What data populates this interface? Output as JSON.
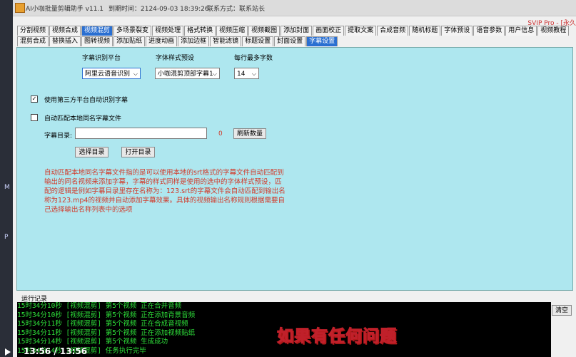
{
  "desktop": {
    "edge_letters": [
      "M",
      "P"
    ]
  },
  "title": {
    "app_name": "AI小咖批量剪辑助手 v11.1",
    "expire": "到期时间：2124-09-03 18:39:26",
    "contact": "联系方式：联系站长"
  },
  "svip_text": "SVIP Pro - [永久",
  "tabs_row1": [
    "分割视频",
    "视频合成",
    "视频混剪",
    "多场景裂变",
    "视频处理",
    "格式转换",
    "视频压缩",
    "视频截图",
    "添加封面",
    "画面校正",
    "提取文案",
    "合成音频",
    "随机标题",
    "字体预设",
    "语音参数",
    "用户信息",
    "视频教程"
  ],
  "tabs_row1_selected": "视频混剪",
  "tabs_row2": [
    "混剪合成",
    "替换插入",
    "图转视频",
    "添加贴纸",
    "进度动画",
    "添加边框",
    "智能滤镜",
    "标题设置",
    "封面设置",
    "字幕设置"
  ],
  "tabs_row2_selected": "字幕设置",
  "subtitle": {
    "platform_label": "字幕识别平台",
    "platform_value": "阿里云语音识别",
    "style_label": "字体样式预设",
    "style_value": "小咖混剪顶部字幕1",
    "maxchars_label": "每行最多字数",
    "maxchars_value": "14",
    "third_party_label": "使用第三方平台自动识别字幕",
    "third_party_checked": true,
    "auto_match_label": "自动匹配本地同名字幕文件",
    "auto_match_checked": false,
    "dir_label": "字幕目录:",
    "dir_value": "",
    "count": "0",
    "refresh_label": "刷新数量",
    "select_dir_label": "选择目录",
    "open_dir_label": "打开目录",
    "description": "自动匹配本地同名字幕文件指的是可以使用本地的srt格式的字幕文件自动匹配到输出的同名视频来添加字幕，字幕的样式同样是使用的选中的字体样式预设，匹配的逻辑是例如字幕目录里存在名称为：123.srt的字幕文件会自动匹配到输出名称为123.mp4的视频并自动添加字幕效果。具体的视频输出名称规则根据需要自己选择输出名称列表中的选项"
  },
  "log": {
    "label": "运行记录",
    "lines": [
      "15时34分10秒 [视频混剪] 第5个视频 正在合并音频",
      "15时34分10秒 [视频混剪] 第5个视频 正在添加背景音频",
      "15时34分11秒 [视频混剪] 第5个视频 正在合成音视频",
      "15时34分11秒 [视频混剪] 第5个视频 正在添加视频贴纸",
      "15时34分14秒 [视频混剪] 第5个视频 生成成功",
      "15时34分14秒 [视频混剪] 任务执行完毕"
    ],
    "clear_label": "清空"
  },
  "overlay_caption": "如果有任何问题",
  "video": {
    "time": "13:56 / 13:56"
  }
}
